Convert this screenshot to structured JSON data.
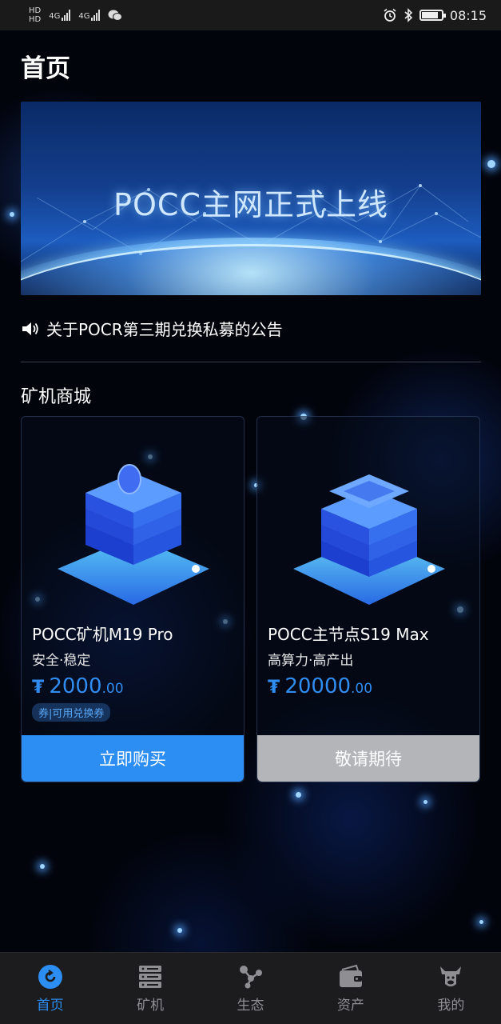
{
  "status_bar": {
    "network_left": [
      "HD",
      "HD"
    ],
    "signal_1": "4G",
    "signal_2": "4G",
    "time": "08:15",
    "battery_level": 0.85
  },
  "header": {
    "title": "首页"
  },
  "banner": {
    "title": "POCC主网正式上线"
  },
  "notice": {
    "text": "关于POCR第三期兑换私募的公告"
  },
  "shop": {
    "title": "矿机商城",
    "products": [
      {
        "name": "POCC矿机M19 Pro",
        "tagline": "安全·稳定",
        "currency_symbol": "₮",
        "price_int": "2000",
        "price_dec": ".00",
        "badge": "券|可用兑换券",
        "button": "立即购买",
        "button_color": "#2c8df2"
      },
      {
        "name": "POCC主节点S19 Max",
        "tagline": "高算力·高产出",
        "currency_symbol": "₮",
        "price_int": "20000",
        "price_dec": ".00",
        "button": "敬请期待",
        "button_color": "#b3b5b9"
      }
    ]
  },
  "bottom_nav": {
    "items": [
      {
        "label": "首页",
        "icon": "home-icon",
        "active": true
      },
      {
        "label": "矿机",
        "icon": "server-icon",
        "active": false
      },
      {
        "label": "生态",
        "icon": "ecosystem-icon",
        "active": false
      },
      {
        "label": "资产",
        "icon": "wallet-icon",
        "active": false
      },
      {
        "label": "我的",
        "icon": "profile-icon",
        "active": false
      }
    ],
    "active_color": "#2c8df2",
    "inactive_color": "#8e8e93"
  },
  "theme": {
    "accent": "#2c8df2",
    "background": "#02040c"
  }
}
